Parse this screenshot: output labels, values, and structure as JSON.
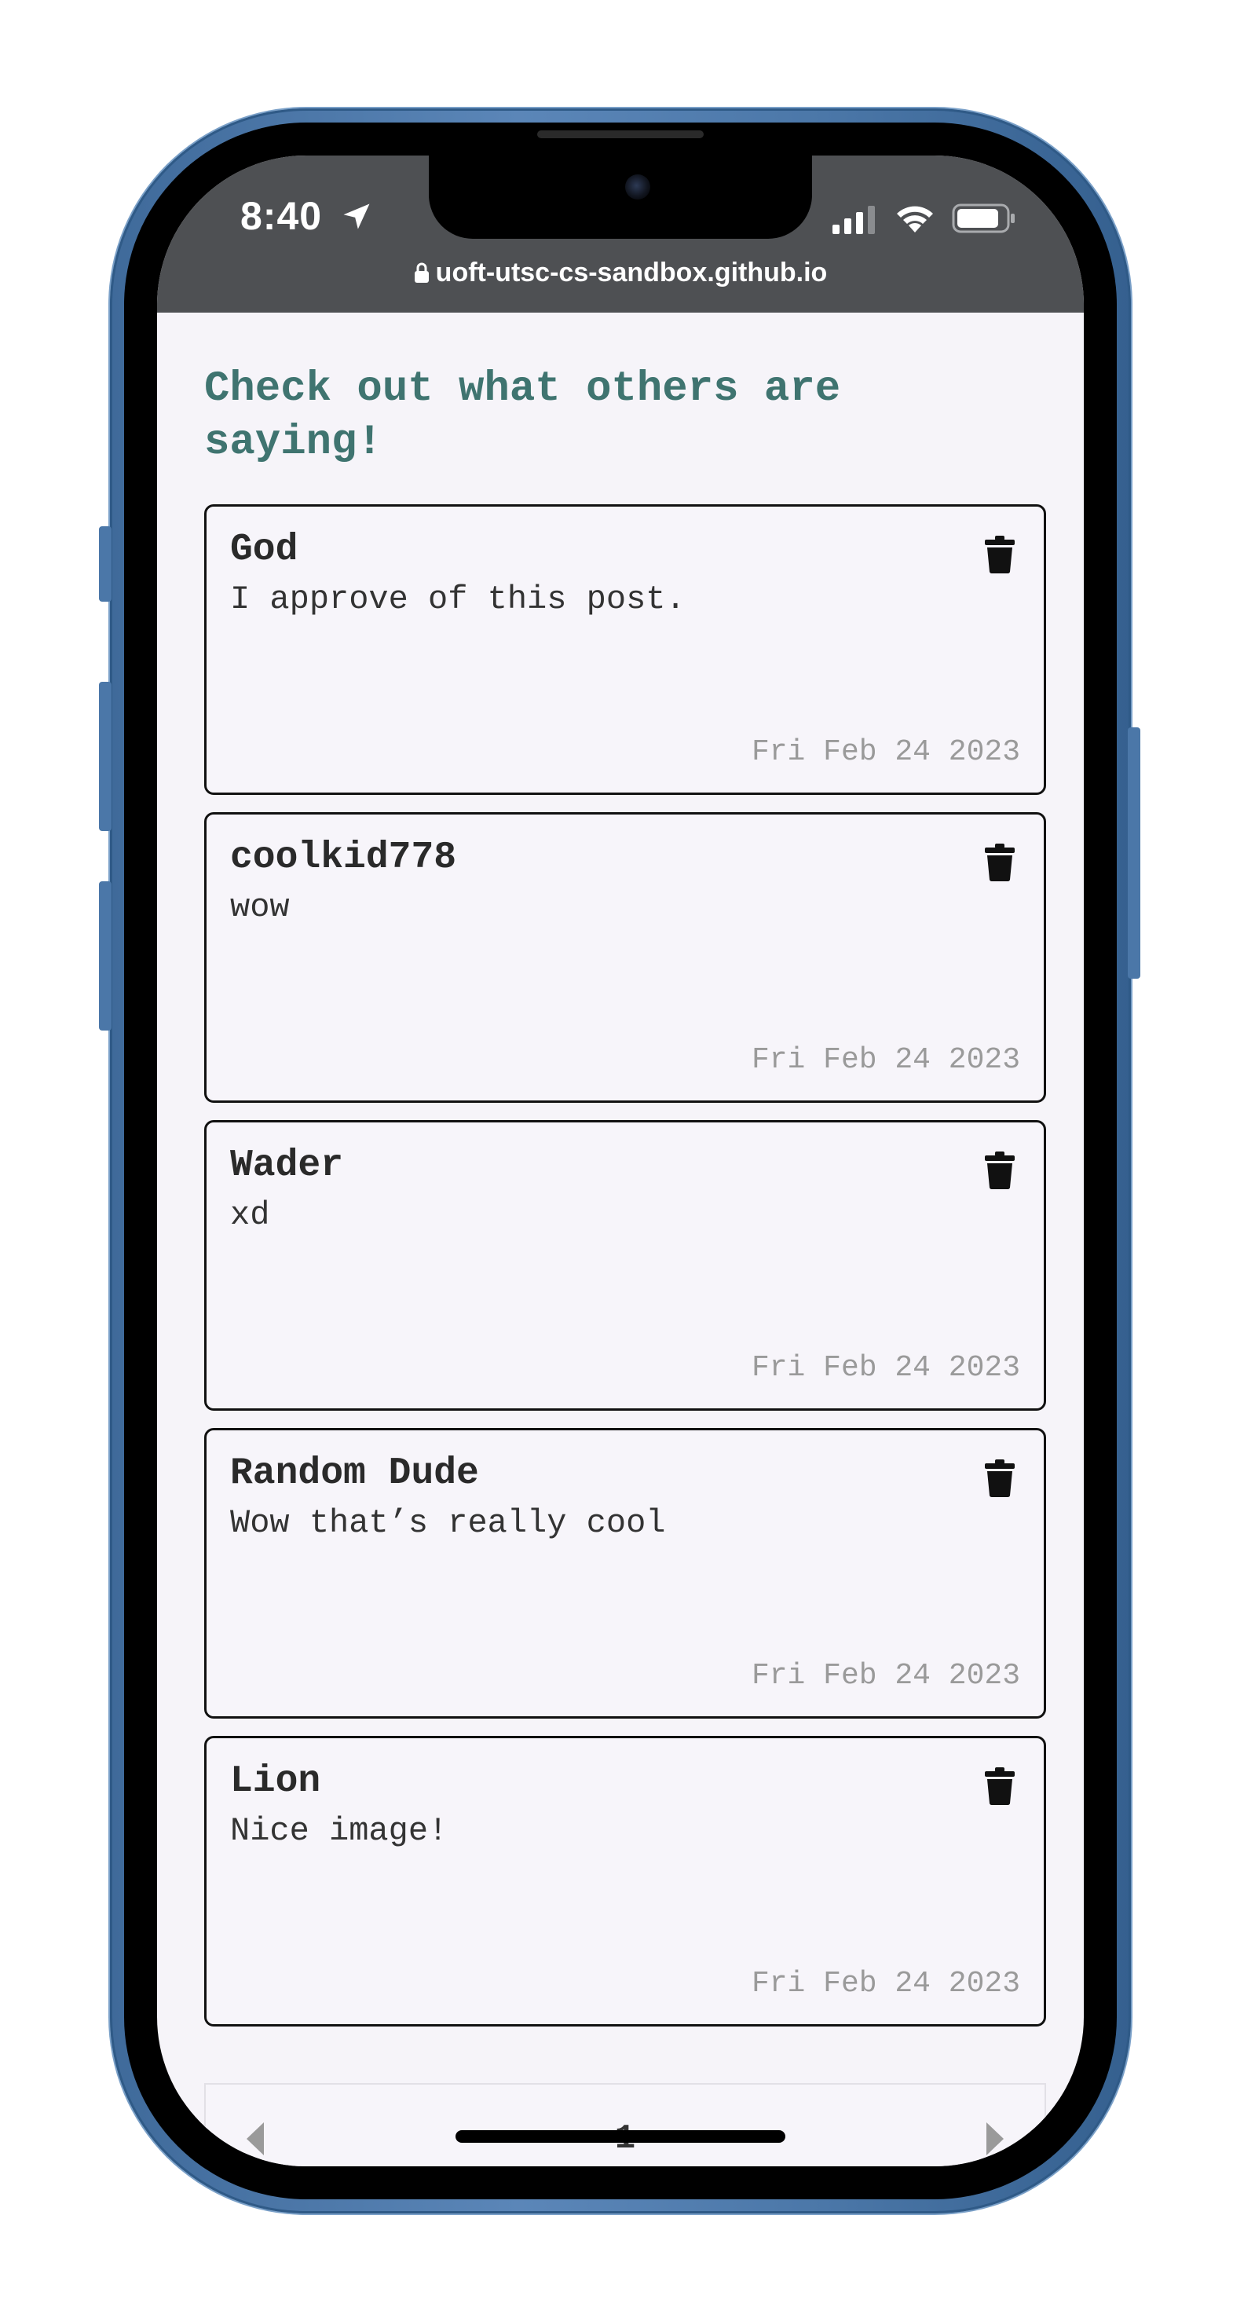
{
  "status_bar": {
    "time": "8:40",
    "url": "uoft-utsc-cs-sandbox.github.io"
  },
  "page": {
    "heading": "Check out what others are saying!"
  },
  "comments": [
    {
      "name": "God",
      "message": "I approve of this post.",
      "date": "Fri Feb 24 2023"
    },
    {
      "name": "coolkid778",
      "message": "wow",
      "date": "Fri Feb 24 2023"
    },
    {
      "name": "Wader",
      "message": "xd",
      "date": "Fri Feb 24 2023"
    },
    {
      "name": "Random Dude",
      "message": "Wow that’s really cool",
      "date": "Fri Feb 24 2023"
    },
    {
      "name": "Lion",
      "message": "Nice image!",
      "date": "Fri Feb 24 2023"
    }
  ],
  "pagination": {
    "current_page": "1"
  },
  "icons": {
    "delete": "trash-icon",
    "prev": "caret-left-icon",
    "next": "caret-right-icon",
    "location": "location-arrow-icon",
    "signal": "cellular-signal-icon",
    "wifi": "wifi-icon",
    "battery": "battery-icon",
    "lock": "lock-icon"
  },
  "colors": {
    "heading": "#3f7470",
    "status_bar": "#4e5053",
    "page_background": "#f6f4f9",
    "phone_frame": "#4b77a8"
  }
}
